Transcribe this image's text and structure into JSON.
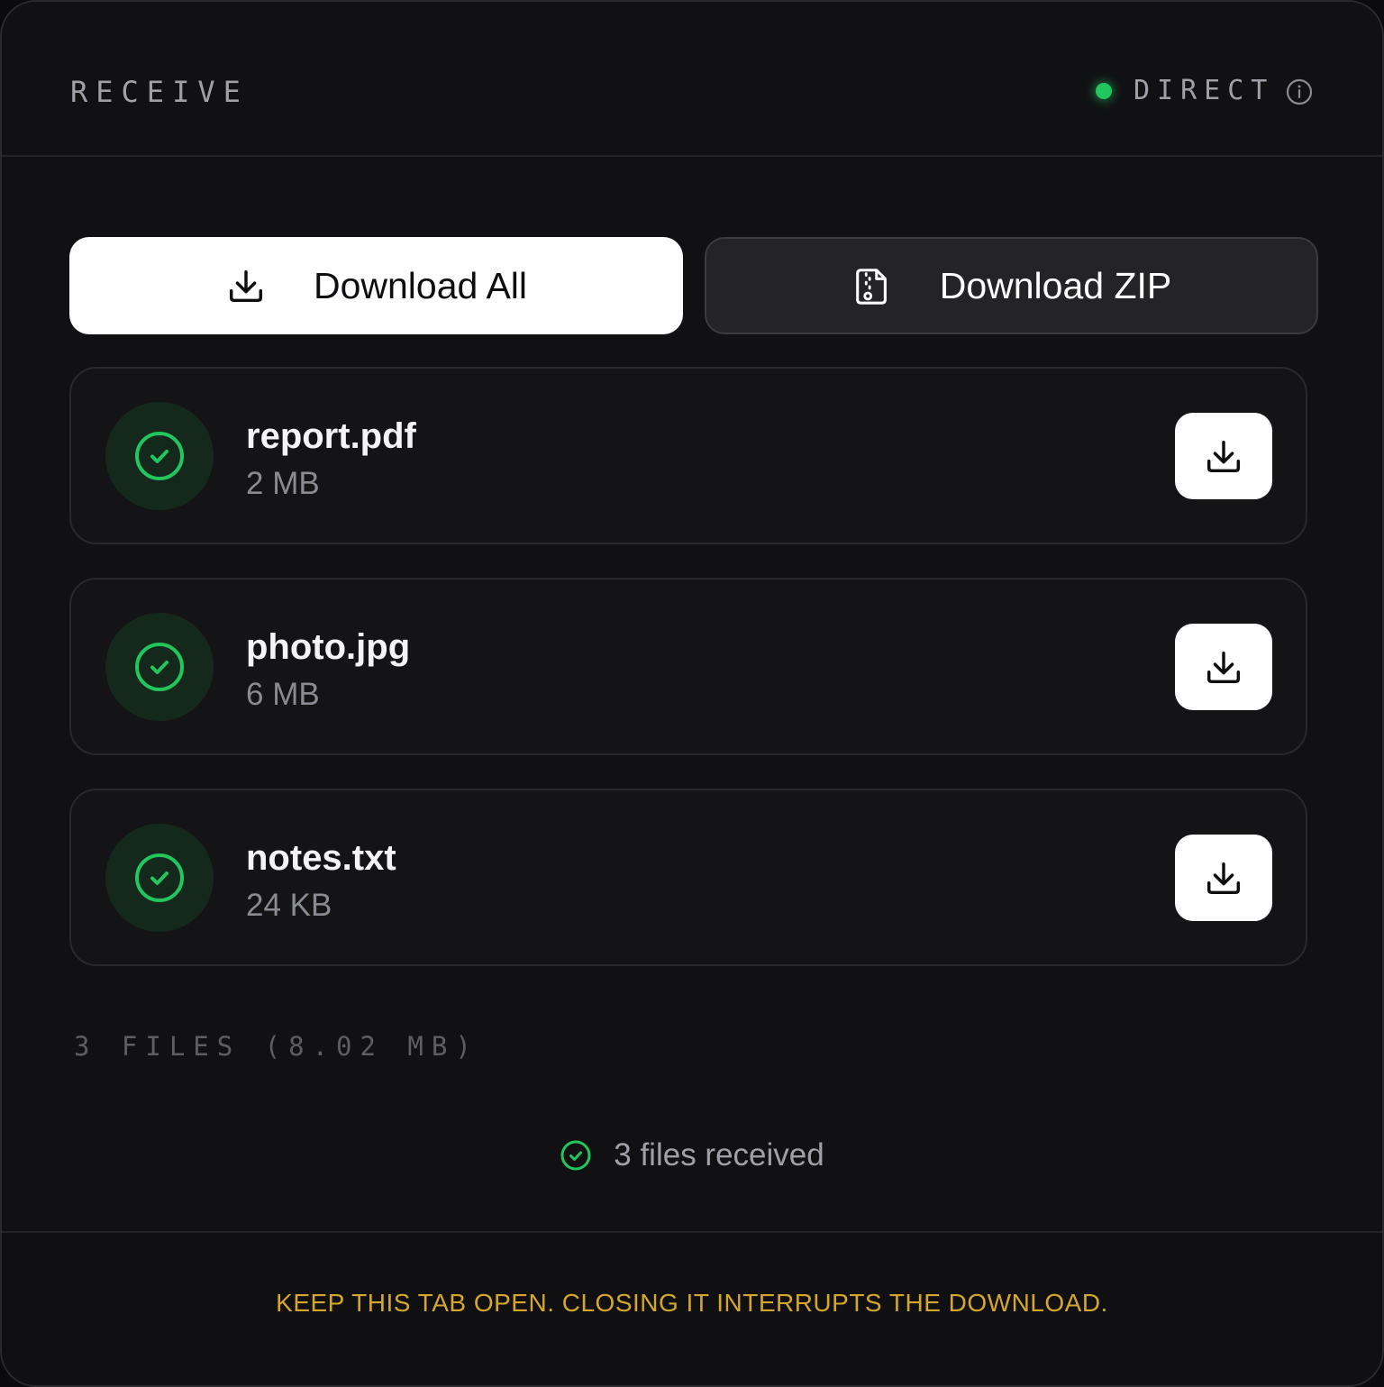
{
  "header": {
    "title": "RECEIVE",
    "status_label": "DIRECT",
    "status_color": "#22c55e",
    "info_icon": "info-icon"
  },
  "actions": {
    "download_all_label": "Download All",
    "download_all_icon": "download-icon",
    "download_zip_label": "Download ZIP",
    "download_zip_icon": "zip-file-icon"
  },
  "files": [
    {
      "name": "report.pdf",
      "size": "2 MB",
      "status_icon": "check-circle-icon"
    },
    {
      "name": "photo.jpg",
      "size": "6 MB",
      "status_icon": "check-circle-icon"
    },
    {
      "name": "notes.txt",
      "size": "24 KB",
      "status_icon": "check-circle-icon"
    }
  ],
  "summary": "3 FILES (8.02 MB)",
  "received_text": "3 files received",
  "footer_note": "KEEP THIS TAB OPEN. CLOSING IT INTERRUPTS THE DOWNLOAD.",
  "colors": {
    "accent_green": "#22c55e",
    "warning": "#d4a72c",
    "background": "#111114"
  }
}
